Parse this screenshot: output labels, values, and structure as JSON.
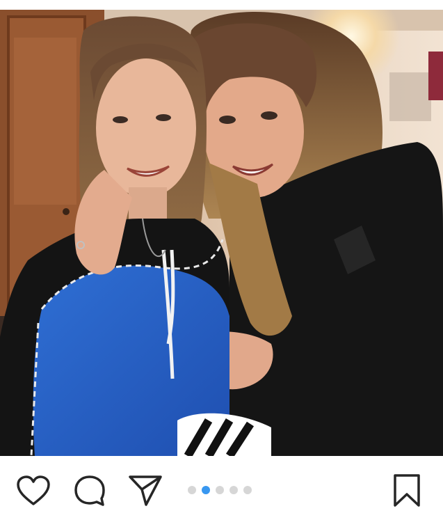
{
  "post": {
    "image_alt": "",
    "carousel": {
      "total": 5,
      "active_index": 1
    }
  },
  "actions": {
    "like_icon": "heart-icon",
    "comment_icon": "comment-icon",
    "share_icon": "paper-plane-icon",
    "save_icon": "bookmark-icon"
  },
  "colors": {
    "active_dot": "#3897f0",
    "inactive_dot": "#d6d6d6",
    "icon_stroke": "#262626"
  }
}
